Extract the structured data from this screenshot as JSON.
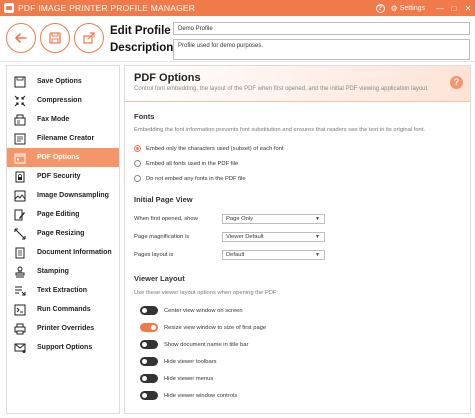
{
  "titlebar": {
    "title": "PDF IMAGE PRINTER PROFILE MANAGER",
    "help": "?",
    "settings": "Settings",
    "minimize": "—",
    "maximize": "□",
    "close": "✕"
  },
  "header": {
    "edit_label": "Edit Profile -",
    "description_label": "Description",
    "profile_name": "Demo Profile",
    "profile_description": "Profile used for demo purposes."
  },
  "sidebar": {
    "items": [
      {
        "label": "Save Options",
        "icon": "save-icon"
      },
      {
        "label": "Compression",
        "icon": "compress-icon"
      },
      {
        "label": "Fax Mode",
        "icon": "fax-icon"
      },
      {
        "label": "Filename Creator",
        "icon": "filename-icon"
      },
      {
        "label": "PDF Options",
        "icon": "pdf-options-icon"
      },
      {
        "label": "PDF Security",
        "icon": "pdf-security-icon"
      },
      {
        "label": "Image Downsampling",
        "icon": "downsampling-icon"
      },
      {
        "label": "Page Editing",
        "icon": "page-editing-icon"
      },
      {
        "label": "Page Resizing",
        "icon": "page-resizing-icon"
      },
      {
        "label": "Document Information",
        "icon": "document-info-icon"
      },
      {
        "label": "Stamping",
        "icon": "stamp-icon"
      },
      {
        "label": "Text Extraction",
        "icon": "text-extraction-icon"
      },
      {
        "label": "Run Commands",
        "icon": "run-commands-icon"
      },
      {
        "label": "Printer Overrides",
        "icon": "printer-icon"
      },
      {
        "label": "Support Options",
        "icon": "support-icon"
      }
    ],
    "active": "PDF Options"
  },
  "main": {
    "title": "PDF Options",
    "description": "Control font embedding, the layout of the PDF when first opened, and the initial PDF viewing application layout.",
    "help": "?",
    "fonts": {
      "title": "Fonts",
      "description": "Embedding the font information prevents font substitution and ensures that readers see the text in its original font.",
      "options": [
        {
          "label": "Embed only the characters used (subset) of each font",
          "checked": true
        },
        {
          "label": "Embed all fonts used in the PDF file",
          "checked": false
        },
        {
          "label": "Do not embed any fonts in the PDF file",
          "checked": false
        }
      ]
    },
    "initial_view": {
      "title": "Initial Page View",
      "fields": [
        {
          "label": "When first opened, show",
          "value": "Page Only"
        },
        {
          "label": "Page magnification is",
          "value": "Viewer Default"
        },
        {
          "label": "Pages layout is",
          "value": "Default"
        }
      ]
    },
    "viewer_layout": {
      "title": "Viewer Layout",
      "description": "Use these viewer layout options when opening the PDF:",
      "toggles": [
        {
          "label": "Center view window on screen",
          "on": false
        },
        {
          "label": "Resize view window to size of first page",
          "on": true
        },
        {
          "label": "Show document name in title bar",
          "on": false
        },
        {
          "label": "Hide viewer toolbars",
          "on": false
        },
        {
          "label": "Hide viewer menus",
          "on": false
        },
        {
          "label": "Hide viewer window controls",
          "on": false
        }
      ]
    }
  },
  "colors": {
    "accent": "#f07a4a",
    "active_nav": "#f5956a"
  }
}
